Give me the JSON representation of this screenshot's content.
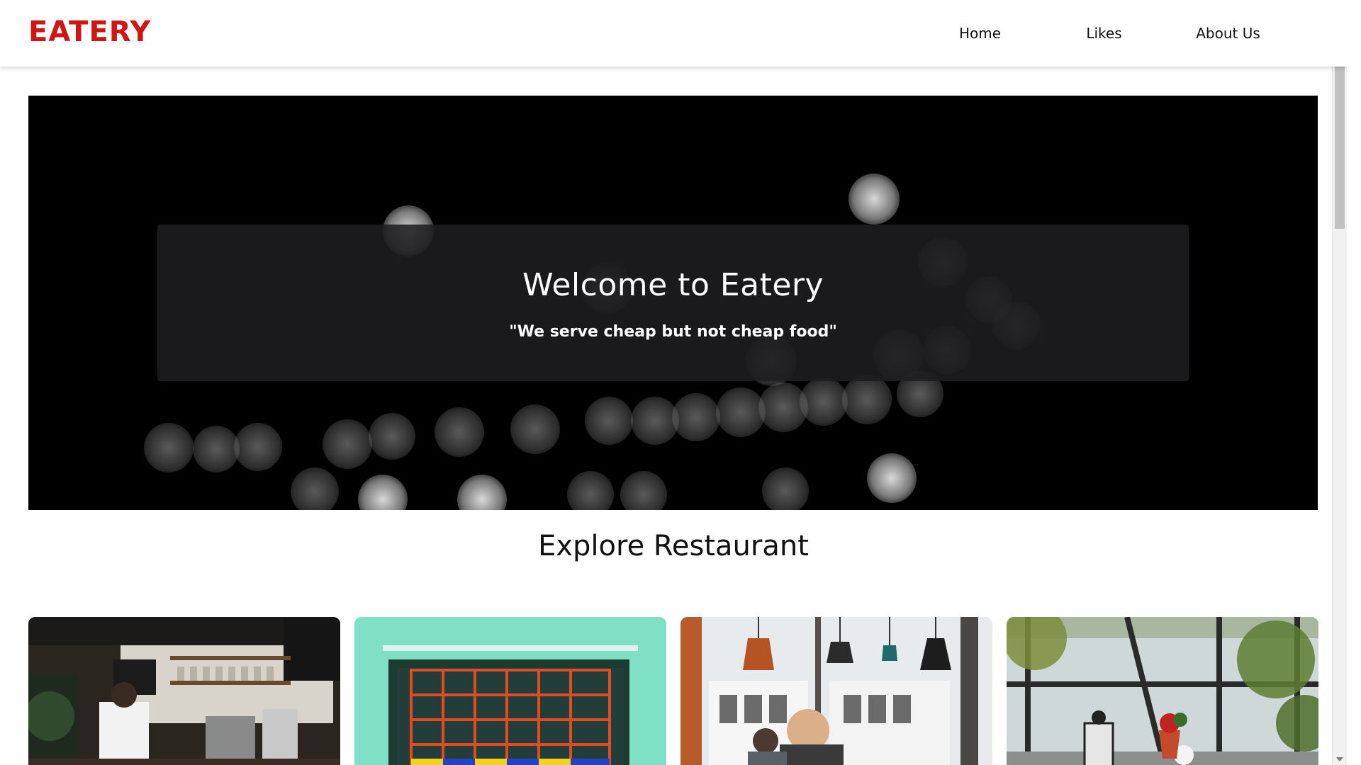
{
  "header": {
    "brand": "EATERY",
    "brand_color": "#d01515",
    "nav": [
      {
        "label": "Home"
      },
      {
        "label": "Likes"
      },
      {
        "label": "About Us"
      }
    ]
  },
  "hero": {
    "title": "Welcome to Eatery",
    "tagline": "\"We serve cheap but not cheap food\""
  },
  "explore": {
    "title": "Explore Restaurant",
    "cards": [
      {
        "image": "restaurant-kitchen-photo"
      },
      {
        "image": "teal-storefront-window-photo"
      },
      {
        "image": "cafe-pendant-lamps-photo"
      },
      {
        "image": "greenhouse-cafe-table-photo"
      }
    ]
  }
}
